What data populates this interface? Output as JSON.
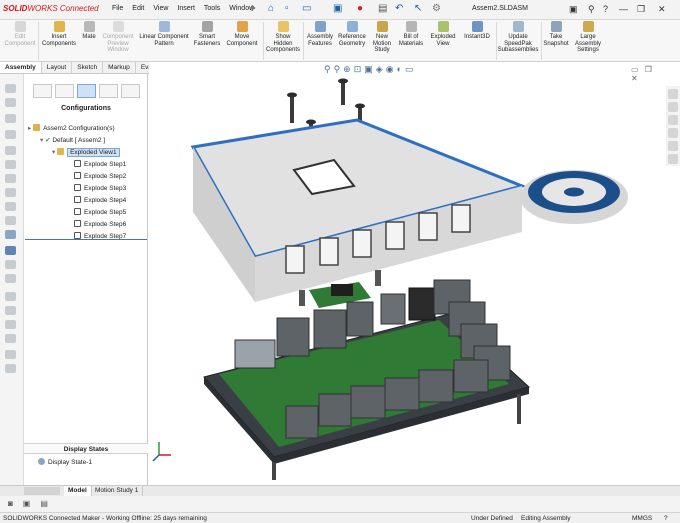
{
  "app": {
    "brand_prefix": "SOLID",
    "brand_rest": "WORKS Connected",
    "menus": [
      "File",
      "Edit",
      "View",
      "Insert",
      "Tools",
      "Window"
    ],
    "document_title": "Assem2.SLDASM"
  },
  "ribbon": {
    "buttons": [
      {
        "label1": "Edit",
        "label2": "Component",
        "label3": "",
        "disabled": true,
        "icon": "edit-component-icon"
      },
      {
        "label1": "Insert",
        "label2": "Components",
        "label3": "",
        "disabled": false,
        "icon": "insert-components-icon"
      },
      {
        "label1": "Mate",
        "label2": "",
        "label3": "",
        "disabled": false,
        "icon": "mate-icon"
      },
      {
        "label1": "Component",
        "label2": "Preview",
        "label3": "Window",
        "disabled": true,
        "icon": "component-preview-icon"
      },
      {
        "label1": "Linear Component",
        "label2": "Pattern",
        "label3": "",
        "disabled": false,
        "icon": "linear-pattern-icon"
      },
      {
        "label1": "Smart",
        "label2": "Fasteners",
        "label3": "",
        "disabled": false,
        "icon": "smart-fasteners-icon"
      },
      {
        "label1": "Move",
        "label2": "Component",
        "label3": "",
        "disabled": false,
        "icon": "move-component-icon"
      },
      {
        "label1": "Show",
        "label2": "Hidden",
        "label3": "Components",
        "disabled": false,
        "icon": "show-hidden-icon"
      },
      {
        "label1": "Assembly",
        "label2": "Features",
        "label3": "",
        "disabled": false,
        "icon": "assembly-features-icon"
      },
      {
        "label1": "Reference",
        "label2": "Geometry",
        "label3": "",
        "disabled": false,
        "icon": "reference-geometry-icon"
      },
      {
        "label1": "New",
        "label2": "Motion",
        "label3": "Study",
        "disabled": false,
        "icon": "motion-study-icon"
      },
      {
        "label1": "Bill of",
        "label2": "Materials",
        "label3": "",
        "disabled": false,
        "icon": "bom-icon"
      },
      {
        "label1": "Exploded",
        "label2": "View",
        "label3": "",
        "disabled": false,
        "icon": "exploded-view-icon"
      },
      {
        "label1": "Instant3D",
        "label2": "",
        "label3": "",
        "disabled": false,
        "icon": "instant3d-icon"
      },
      {
        "label1": "Update",
        "label2": "SpeedPak",
        "label3": "Subassemblies",
        "disabled": false,
        "icon": "speedpak-icon"
      },
      {
        "label1": "Take",
        "label2": "Snapshot",
        "label3": "",
        "disabled": false,
        "icon": "snapshot-icon"
      },
      {
        "label1": "Large",
        "label2": "Assembly",
        "label3": "Settings",
        "disabled": false,
        "icon": "large-assembly-icon"
      }
    ]
  },
  "command_tabs": [
    "Assembly",
    "Layout",
    "Sketch",
    "Markup",
    "Evaluate"
  ],
  "manager": {
    "title": "Configurations",
    "root": "Assem2 Configuration(s)",
    "config": "Default [ Assem2 ]",
    "exploded": "Exploded View1",
    "steps": [
      "Explode Step1",
      "Explode Step2",
      "Explode Step3",
      "Explode Step4",
      "Explode Step5",
      "Explode Step6",
      "Explode Step7"
    ],
    "display_states_title": "Display States",
    "display_state": "Display State-1"
  },
  "bottom_tabs": [
    "Model",
    "Motion Study 1"
  ],
  "status": {
    "left": "SOLIDWORKS Connected Maker - Working Offline: 25 days remaining",
    "state": "Under Defined",
    "mode": "Editing Assembly",
    "units": "MMGS"
  },
  "colors": {
    "brand": "#d71920",
    "accent": "#3a77c8",
    "selection": "#cfe2f5",
    "pcb": "#2f7a34",
    "case": "#dcdcdc",
    "gear": "#1c4f8a"
  }
}
